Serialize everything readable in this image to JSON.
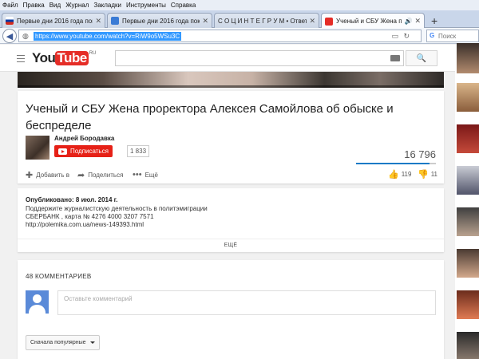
{
  "menubar": [
    "Файл",
    "Правка",
    "Вид",
    "Журнал",
    "Закладки",
    "Инструменты",
    "Справка"
  ],
  "tabs": [
    {
      "title": "Первые дни 2016 года пок...",
      "active": false,
      "favicon_color": "#c8102e"
    },
    {
      "title": "Первые дни 2016 года пок...",
      "active": false,
      "favicon_color": "#3a7bd5"
    },
    {
      "title": "С О Ц И Н Т Е Г Р У М • Ответ...",
      "active": false,
      "favicon_color": "#2b2b2b"
    },
    {
      "title": "Ученый и СБУ Жена п...",
      "active": true,
      "favicon_color": "#e52d27"
    }
  ],
  "navbar": {
    "url": "https://www.youtube.com/watch?v=RiW9o5WSu3C",
    "search_placeholder": "Поиск"
  },
  "yt": {
    "logo_you": "You",
    "logo_tube": "Tube",
    "logo_region": "RU",
    "video": {
      "title": "Ученый и СБУ Жена проректора Алексея Самойлова об обыске и беспределе",
      "channel": "Андрей Бородавка",
      "subscribe_label": "Подписаться",
      "subscriber_count": "1 833",
      "views": "16 796",
      "likes": "119",
      "dislikes": "11",
      "like_fraction": 0.915,
      "actions": {
        "add": "Добавить в",
        "share": "Поделиться",
        "more": "Ещё"
      }
    },
    "description": {
      "published": "Опубликовано: 8 июл. 2014 г.",
      "lines": [
        "Поддержите журналистскую деятельность в политэмиграции",
        "СБЕРБАНК , карта № 4276 4000 3207 7571",
        "http://polemika.com.ua/news-149393.html"
      ],
      "more_label": "ЕЩЁ"
    },
    "comments": {
      "count_label": "48 КОММЕНТАРИЕВ",
      "placeholder": "Оставьте комментарий",
      "sort_label": "Сначала популярные"
    }
  },
  "colors": {
    "accent_red": "#e62117",
    "link_blue": "#167ac6"
  }
}
